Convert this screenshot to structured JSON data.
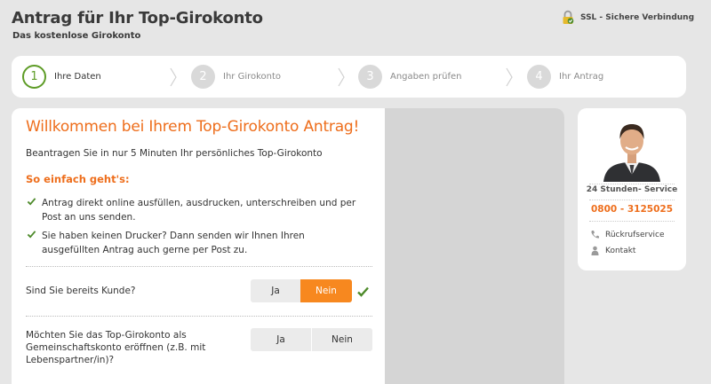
{
  "header": {
    "title": "Antrag für Ihr Top-Girokonto",
    "subtitle": "Das kostenlose Girokonto",
    "ssl_label": "SSL - Sichere Verbindung"
  },
  "steps": [
    {
      "number": "1",
      "label": "Ihre Daten",
      "active": true
    },
    {
      "number": "2",
      "label": "Ihr Girokonto",
      "active": false
    },
    {
      "number": "3",
      "label": "Angaben prüfen",
      "active": false
    },
    {
      "number": "4",
      "label": "Ihr Antrag",
      "active": false
    }
  ],
  "main": {
    "welcome": "Willkommen bei Ihrem Top-Girokonto Antrag!",
    "lead": "Beantragen Sie in nur 5 Minuten Ihr persönliches Top-Girokonto",
    "how_title": "So einfach geht's:",
    "bullets": [
      "Antrag direkt online ausfüllen, ausdrucken, unterschreiben und per Post an uns senden.",
      "Sie haben keinen Drucker? Dann senden wir Ihnen Ihren ausgefüllten Antrag auch gerne per Post zu."
    ],
    "q1": {
      "text": "Sind Sie bereits Kunde?",
      "yes": "Ja",
      "no": "Nein",
      "selected": "Nein"
    },
    "q2": {
      "text": "Möchten Sie das Top-Girokonto als Gemeinschaftskonto eröffnen (z.B. mit Lebenspartner/in)?",
      "yes": "Ja",
      "no": "Nein",
      "selected": null
    }
  },
  "contact": {
    "service": "24 Stunden- Service",
    "phone": "0800 - 3125025",
    "callback": "Rückrufservice",
    "contact": "Kontakt"
  },
  "colors": {
    "accent_orange": "#ee6e1c",
    "toggle_orange": "#f7881f",
    "active_green": "#5e9c27",
    "check_green": "#4d8a2a"
  }
}
